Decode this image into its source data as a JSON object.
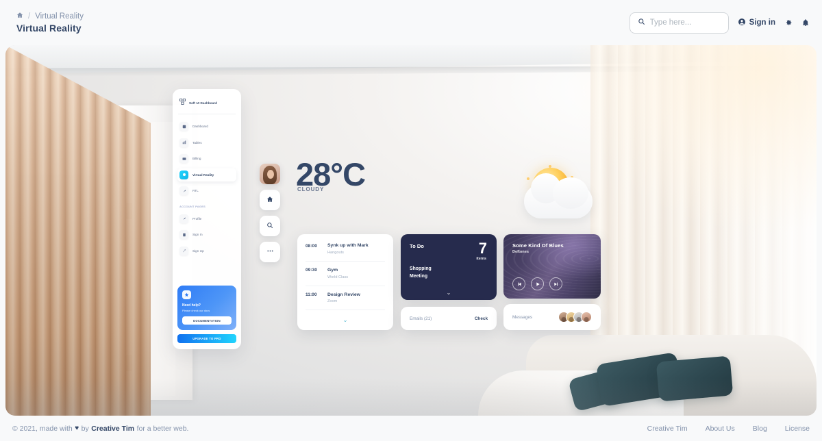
{
  "topnav": {
    "breadcrumb": {
      "home_icon": "home-icon",
      "separator": "/",
      "crumb": "Virtual Reality"
    },
    "page_title": "Virtual Reality",
    "search": {
      "placeholder": "Type here...",
      "value": "",
      "icon": "search-icon"
    },
    "signin_label": "Sign in",
    "signin_icon": "user-circle-icon",
    "settings_icon": "gear-icon",
    "notifications_icon": "bell-icon"
  },
  "vr_sidebar": {
    "brand": "Soft UI Dashboard",
    "brand_icon": "cube-logo-icon",
    "items": [
      {
        "label": "Dashboard",
        "icon": "dashboard-icon",
        "active": false
      },
      {
        "label": "Tables",
        "icon": "tables-icon",
        "active": false
      },
      {
        "label": "Billing",
        "icon": "billing-icon",
        "active": false
      },
      {
        "label": "Virtual Reality",
        "icon": "vr-icon",
        "active": true
      },
      {
        "label": "RTL",
        "icon": "rtl-icon",
        "active": false
      }
    ],
    "section_caption": "ACCOUNT PAGES",
    "account_items": [
      {
        "label": "Profile",
        "icon": "profile-icon"
      },
      {
        "label": "Sign In",
        "icon": "signin-icon"
      },
      {
        "label": "Sign Up",
        "icon": "signup-icon"
      }
    ],
    "help_card": {
      "icon": "star-icon",
      "title": "Need help?",
      "subtitle": "Please check our docs",
      "button": "DOCUMENTATION"
    },
    "upgrade_button": "UPGRADE TO PRO"
  },
  "rail": {
    "avatar": "user-avatar",
    "buttons": [
      {
        "icon": "home-icon",
        "name": "rail-home-button"
      },
      {
        "icon": "search-icon",
        "name": "rail-search-button"
      },
      {
        "icon": "ellipsis-icon",
        "name": "rail-more-button"
      }
    ]
  },
  "weather": {
    "temperature": "28°C",
    "condition": "CLOUDY",
    "illustration": "sun-behind-cloud-icon"
  },
  "schedule": {
    "events": [
      {
        "time": "08:00",
        "title": "Synk up with Mark",
        "subtitle": "Hangouts"
      },
      {
        "time": "09:30",
        "title": "Gym",
        "subtitle": "World Class"
      },
      {
        "time": "11:00",
        "title": "Design Review",
        "subtitle": "Zoom"
      }
    ],
    "expand_icon": "chevron-down-icon"
  },
  "todo": {
    "title": "To Do",
    "count": "7",
    "count_label": "items",
    "items": [
      "Shopping",
      "Meeting"
    ],
    "expand_icon": "chevron-down-icon"
  },
  "emails": {
    "label": "Emails (21)",
    "action": "Check"
  },
  "music": {
    "title": "Some Kind Of Blues",
    "artist": "Deftones",
    "controls": [
      {
        "icon": "skip-previous-icon",
        "name": "previous-button"
      },
      {
        "icon": "play-icon",
        "name": "play-button"
      },
      {
        "icon": "skip-next-icon",
        "name": "next-button"
      }
    ]
  },
  "messages": {
    "label": "Messages",
    "avatar_count": 4
  },
  "footer": {
    "copyright_prefix": "© 2021, made with",
    "heart": "♥",
    "copyright_by": "by",
    "brand": "Creative Tim",
    "copyright_suffix": "for a better web.",
    "links": [
      "Creative Tim",
      "About Us",
      "Blog",
      "License"
    ]
  },
  "colors": {
    "accent_cyan": "#21d4fd",
    "accent_blue": "#2f7cf6",
    "text_dark": "#344767",
    "text_muted": "#8392ab",
    "todo_bg": "#262b4d"
  }
}
